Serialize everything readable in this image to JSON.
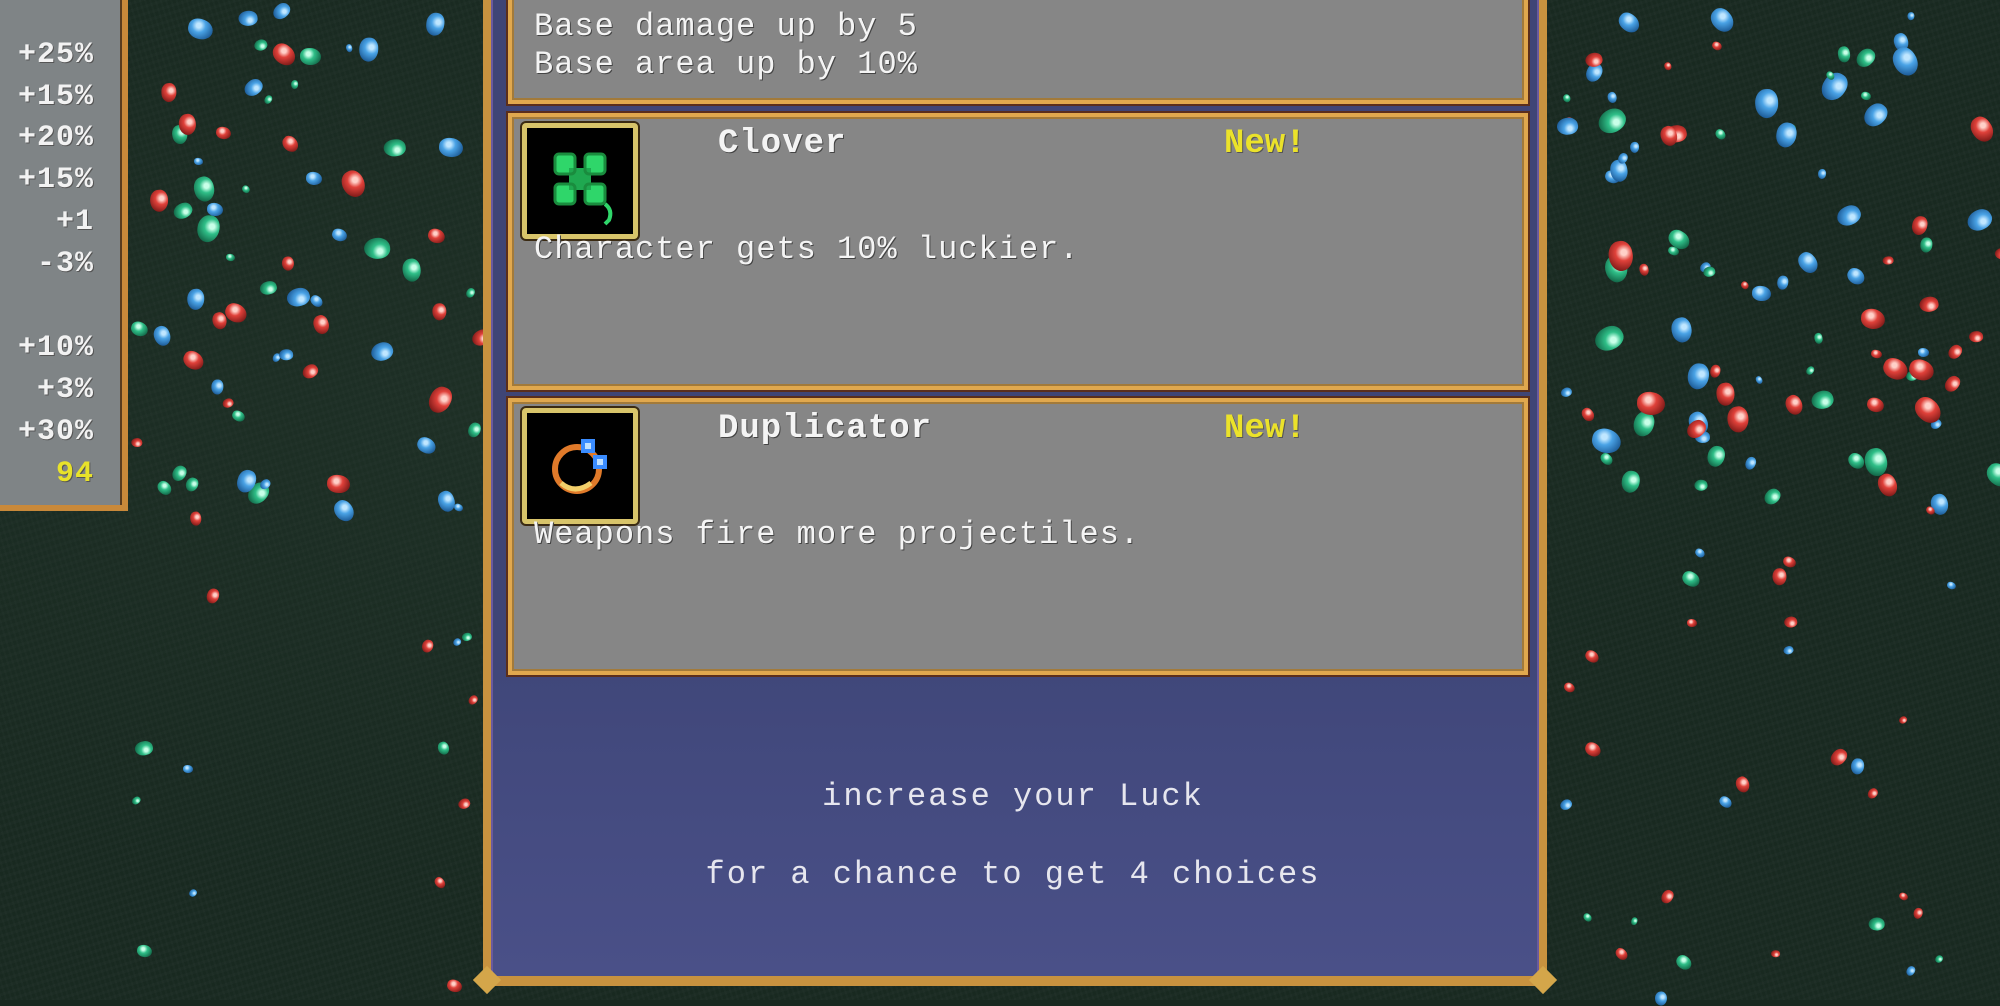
{
  "stats_panel": {
    "values": [
      {
        "text": "+25%",
        "highlight": false
      },
      {
        "text": "+15%",
        "highlight": false
      },
      {
        "text": "+20%",
        "highlight": false
      },
      {
        "text": "+15%",
        "highlight": false
      },
      {
        "text": "+1",
        "highlight": false
      },
      {
        "text": "-3%",
        "highlight": false
      },
      {
        "text": "+10%",
        "highlight": false
      },
      {
        "text": "+3%",
        "highlight": false
      },
      {
        "text": "+30%",
        "highlight": false
      },
      {
        "text": "94",
        "highlight": true
      }
    ]
  },
  "level_up_panel": {
    "cards": [
      {
        "name": "",
        "badge": "",
        "description_lines": [
          "Base damage up by 5",
          "Base area up by 10%"
        ],
        "icon": "weapon-icon"
      },
      {
        "name": "Clover",
        "badge": "New!",
        "description_lines": [
          "Character gets 10% luckier."
        ],
        "icon": "clover-icon"
      },
      {
        "name": "Duplicator",
        "badge": "New!",
        "description_lines": [
          "Weapons fire more projectiles."
        ],
        "icon": "ring-icon"
      }
    ],
    "info_lines": [
      "increase your Luck",
      "for a chance to get 4 choices"
    ]
  },
  "colors": {
    "accent_gold": "#e0a84e",
    "badge_yellow": "#ebe22a",
    "panel_blue": "#3f4576",
    "card_gray": "#868686",
    "gem_blue": "#4aa3e6",
    "gem_green": "#2fbf88",
    "gem_red": "#e0413a"
  }
}
